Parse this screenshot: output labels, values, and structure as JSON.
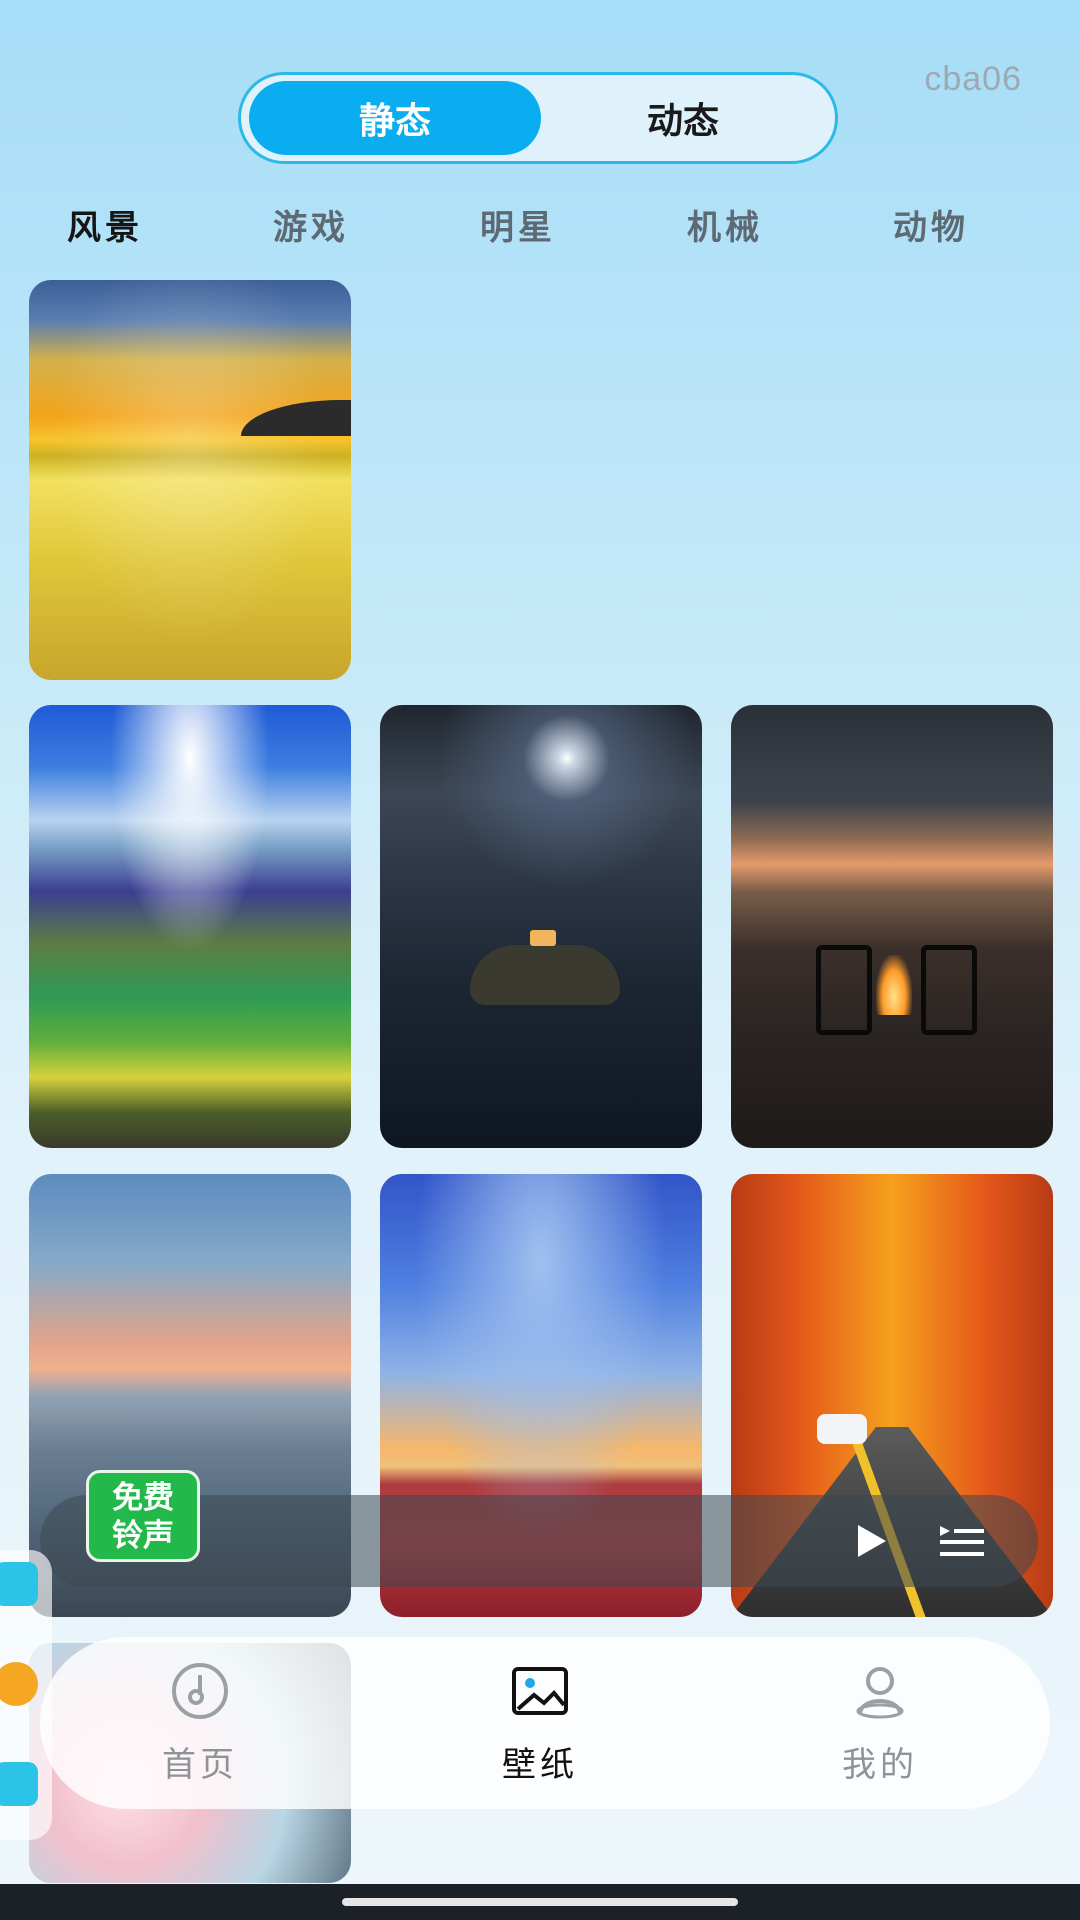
{
  "header": {
    "toggle_static": "静态",
    "toggle_dynamic": "动态",
    "user_code": "cba06"
  },
  "categories": [
    "风景",
    "游戏",
    "明星",
    "机械",
    "动物"
  ],
  "active_category": "风景",
  "player": {
    "ringtone_badge": "免费\n铃声"
  },
  "nav": {
    "home": "首页",
    "wallpaper": "壁纸",
    "mine": "我的"
  },
  "colors": {
    "accent": "#0aaef0",
    "ring_badge": "#22b84a"
  }
}
